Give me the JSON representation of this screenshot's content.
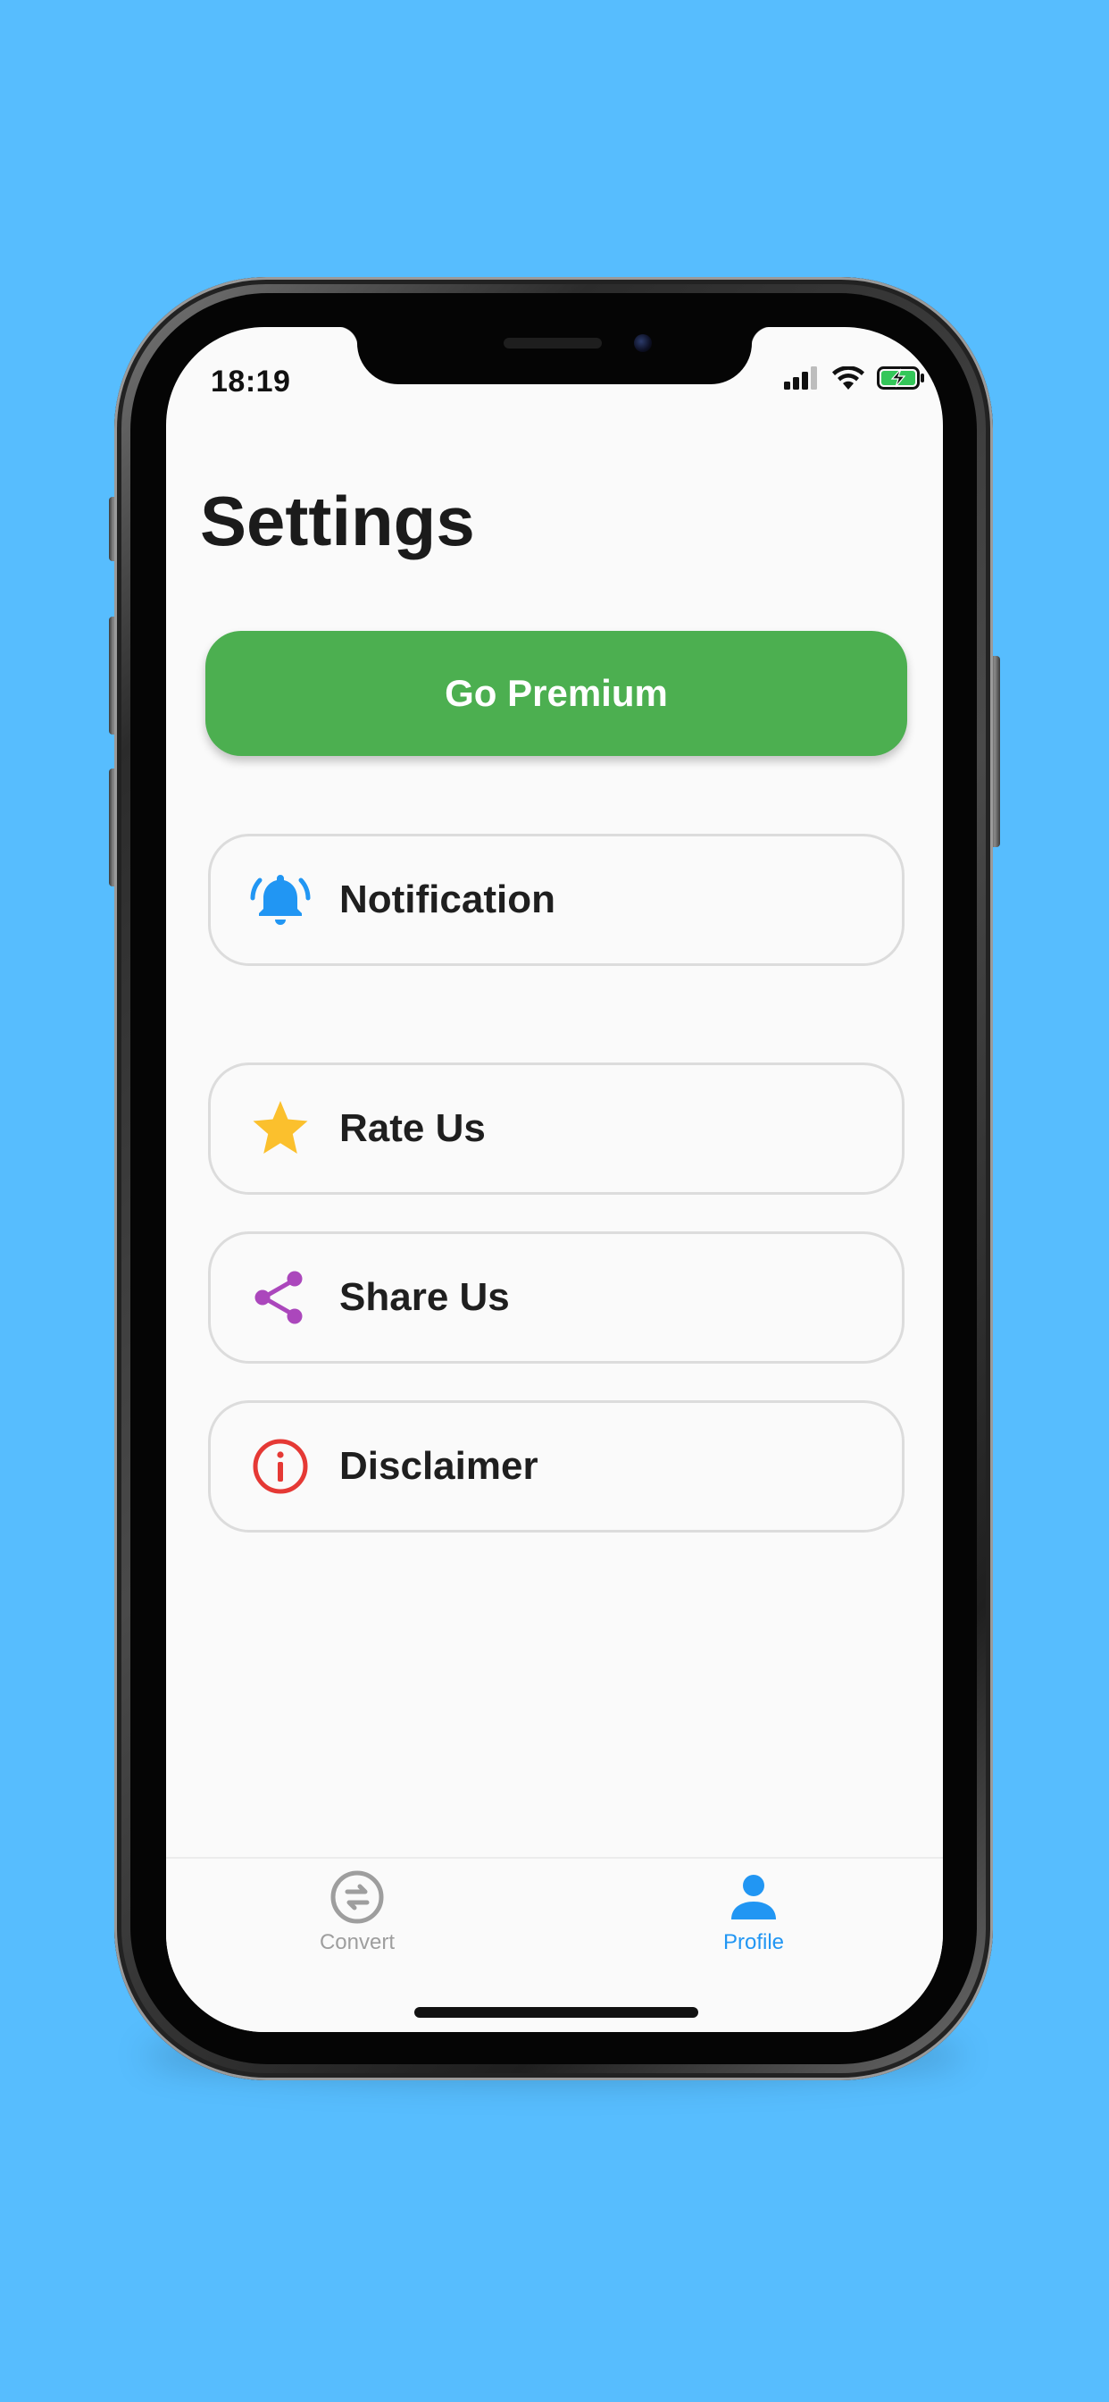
{
  "status_bar": {
    "time": "18:19"
  },
  "page": {
    "title": "Settings"
  },
  "premium": {
    "label": "Go Premium",
    "color": "#4caf50"
  },
  "settings_items": [
    {
      "label": "Notification",
      "icon": "bell-icon",
      "color": "#2196f3"
    },
    {
      "label": "Rate Us",
      "icon": "star-icon",
      "color": "#fbc02d"
    },
    {
      "label": "Share Us",
      "icon": "share-icon",
      "color": "#ab47bc"
    },
    {
      "label": "Disclaimer",
      "icon": "info-icon",
      "color": "#e53935"
    }
  ],
  "tab_bar": {
    "tabs": [
      {
        "label": "Convert",
        "icon": "convert-icon",
        "active": false,
        "color": "#9e9e9e"
      },
      {
        "label": "Profile",
        "icon": "person-icon",
        "active": true,
        "color": "#2196f3"
      }
    ]
  },
  "background_color": "#57bdfe"
}
